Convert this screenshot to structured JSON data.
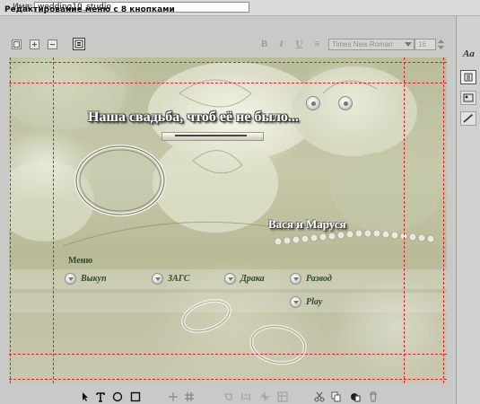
{
  "name_field": {
    "label": "Имя:",
    "value": "wedding10_studio"
  },
  "panel": {
    "title": "Редактирование меню с 8 кнопками"
  },
  "toolbar": {
    "font_name": "Times New Roman",
    "font_size": "16",
    "format_buttons": [
      "B",
      "I",
      "U",
      "≡"
    ]
  },
  "canvas": {
    "title": "Наша свадьба, чтоб её не было...",
    "subtitle": "Вася и Маруся",
    "menu_heading": "Меню",
    "menu_items": [
      {
        "label": "Выкуп"
      },
      {
        "label": "ЗАГС"
      },
      {
        "label": "Драка"
      },
      {
        "label": "Развод"
      },
      {
        "label": "Play"
      }
    ]
  },
  "side": {
    "text_style_label": "Aa"
  },
  "colors": {
    "guide": "#e0242a",
    "menu_text": "#2d4d2a",
    "panel_bg": "#c9c9c7"
  },
  "icons": {
    "top_toolbar": [
      "frame-icon",
      "plus-icon",
      "minus-icon",
      "text-layer-icon"
    ],
    "bottom_toolbar": [
      "pointer-icon",
      "text-tool-icon",
      "ellipse-tool-icon",
      "rectangle-tool-icon",
      "move-icon",
      "grid-icon",
      "align-icon",
      "distribute-icon",
      "table-icon",
      "cut-icon",
      "copy-icon",
      "paste-icon",
      "trash-icon"
    ],
    "side": [
      "text-style-icon",
      "button-layout-icon",
      "slideshow-icon",
      "wand-icon"
    ]
  }
}
